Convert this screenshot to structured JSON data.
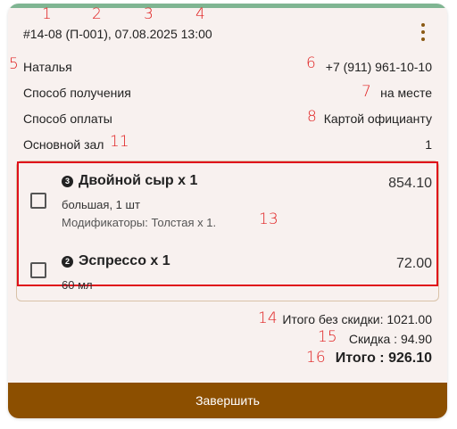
{
  "order": {
    "header": "#14-08 (П-001), 07.08.2025 13:00",
    "customer_name": "Наталья",
    "phone": "+7 (911) 961-10-10",
    "receive_label": "Способ получения",
    "receive_value": "на месте",
    "payment_label": "Способ оплаты",
    "payment_value": "Картой официанту",
    "hall_label": "Основной зал",
    "hall_value": "1"
  },
  "items": [
    {
      "badge": "3",
      "title": "Двойной сыр х 1",
      "price": "854.10",
      "sub": "большая, 1 шт",
      "modifiers": "Модификаторы: Толстая х 1."
    },
    {
      "badge": "2",
      "title": "Эспрессо х 1",
      "price": "72.00",
      "sub": "60 мл"
    }
  ],
  "totals": {
    "subtotal": "Итого без скидки: 1021.00",
    "discount": "Скидка : 94.90",
    "total": "Итого : 926.10"
  },
  "finish_button": "Завершить",
  "annotations": [
    "1",
    "2",
    "3",
    "4",
    "5",
    "6",
    "7",
    "8",
    "11",
    "13",
    "14",
    "15",
    "16"
  ],
  "colors": {
    "accent": "#8c4f00",
    "top_strip": "#7fb592",
    "annotation": "#e02020",
    "card_bg": "#f8f1ef"
  }
}
